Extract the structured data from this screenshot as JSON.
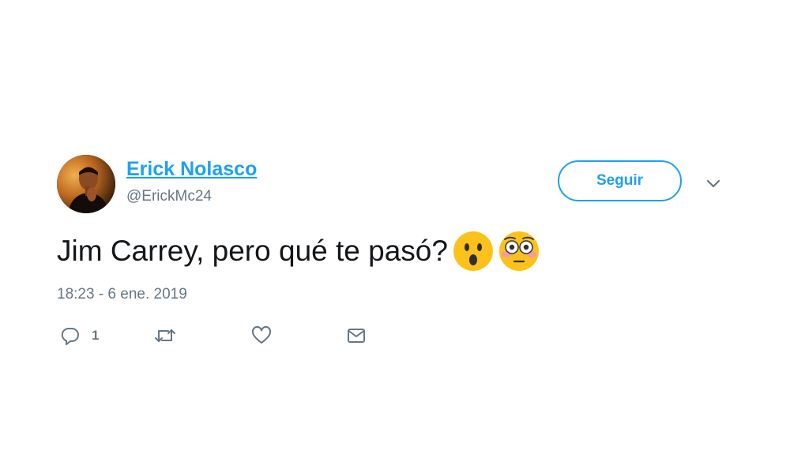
{
  "tweet": {
    "author": {
      "display_name": "Erick Nolasco",
      "handle": "@ErickMc24",
      "avatar_icon": "avatar-photo"
    },
    "follow_label": "Seguir",
    "text": "Jim Carrey, pero qué te pasó?",
    "emojis": [
      "hushed-face-emoji",
      "flushed-face-emoji"
    ],
    "timestamp": "18:23 - 6 ene. 2019",
    "actions": {
      "reply": {
        "icon": "reply-icon",
        "count": "1"
      },
      "retweet": {
        "icon": "retweet-icon"
      },
      "like": {
        "icon": "heart-icon"
      },
      "message": {
        "icon": "envelope-icon"
      }
    },
    "menu_icon": "chevron-down-icon"
  },
  "colors": {
    "accent": "#1da1f2",
    "text": "#14171a",
    "muted": "#657786",
    "background": "#ffffff"
  }
}
